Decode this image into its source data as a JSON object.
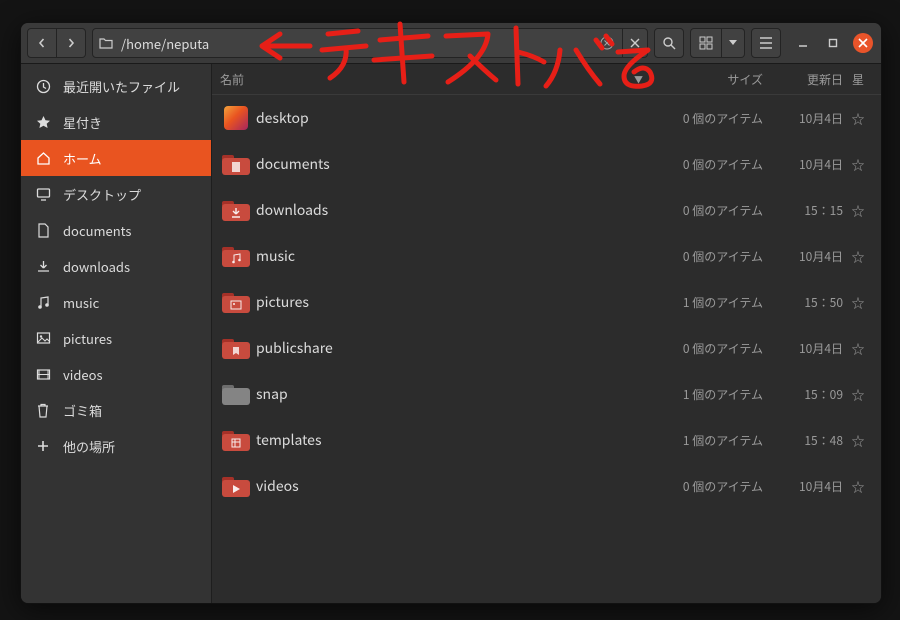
{
  "path": "/home/neputa",
  "annotation_text": "テキストバる",
  "colors": {
    "accent": "#e95420",
    "close": "#e9542a",
    "annotation": "#e71f17"
  },
  "columns": {
    "name": "名前",
    "size": "サイズ",
    "date": "更新日",
    "star": "星"
  },
  "sidebar": {
    "items": [
      {
        "icon": "clock-icon",
        "label": "最近開いたファイル"
      },
      {
        "icon": "star-icon",
        "label": "星付き"
      },
      {
        "icon": "home-icon",
        "label": "ホーム",
        "active": true
      },
      {
        "icon": "desktop-icon",
        "label": "デスクトップ"
      },
      {
        "icon": "doc-icon",
        "label": "documents"
      },
      {
        "icon": "download-icon",
        "label": "downloads"
      },
      {
        "icon": "music-icon",
        "label": "music"
      },
      {
        "icon": "picture-icon",
        "label": "pictures"
      },
      {
        "icon": "video-icon",
        "label": "videos"
      },
      {
        "icon": "trash-icon",
        "label": "ゴミ箱"
      },
      {
        "icon": "plus-icon",
        "label": "他の場所"
      }
    ]
  },
  "files": [
    {
      "icon": "desktop",
      "name": "desktop",
      "size": "0 個のアイテム",
      "date": "10月4日"
    },
    {
      "icon": "docs",
      "name": "documents",
      "size": "0 個のアイテム",
      "date": "10月4日"
    },
    {
      "icon": "download",
      "name": "downloads",
      "size": "0 個のアイテム",
      "date": "15：15"
    },
    {
      "icon": "music",
      "name": "music",
      "size": "0 個のアイテム",
      "date": "10月4日"
    },
    {
      "icon": "pictures",
      "name": "pictures",
      "size": "1 個のアイテム",
      "date": "15：50"
    },
    {
      "icon": "public",
      "name": "publicshare",
      "size": "0 個のアイテム",
      "date": "10月4日"
    },
    {
      "icon": "snap",
      "name": "snap",
      "size": "1 個のアイテム",
      "date": "15：09"
    },
    {
      "icon": "templates",
      "name": "templates",
      "size": "1 個のアイテム",
      "date": "15：48"
    },
    {
      "icon": "videos",
      "name": "videos",
      "size": "0 個のアイテム",
      "date": "10月4日"
    }
  ]
}
